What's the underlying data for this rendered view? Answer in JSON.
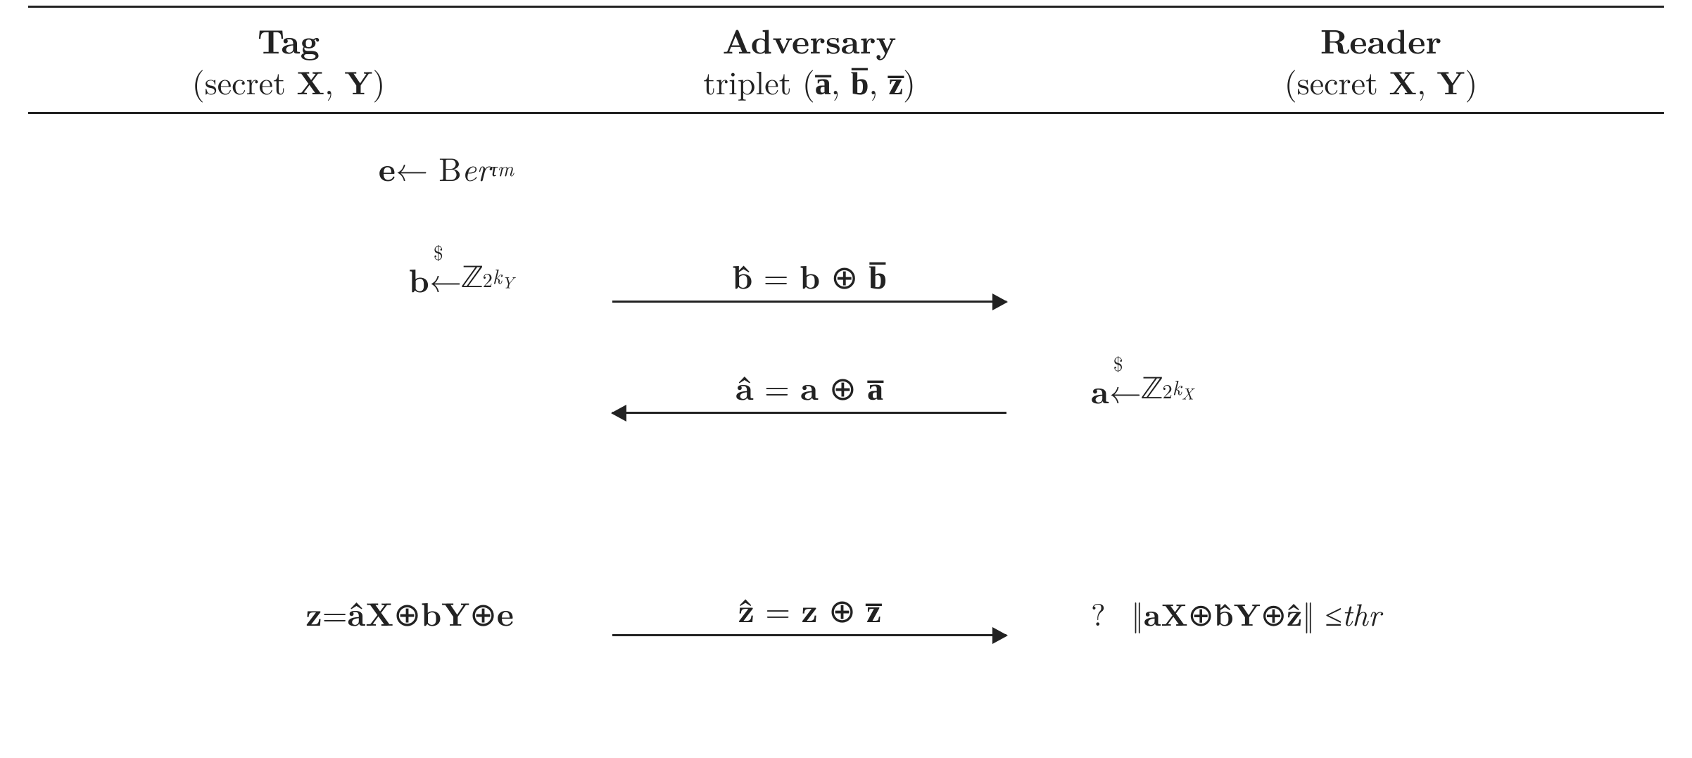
{
  "header": {
    "tag": {
      "title": "Tag",
      "sub": "(secret X, Y)",
      "sub_html": "(secret <b>X</b>, <b>Y</b>)"
    },
    "adv": {
      "title": "Adversary",
      "sub_html": "triplet (<b>a̅</b>, <b>b̅</b>, <b>z̅</b>)"
    },
    "reader": {
      "title": "Reader",
      "sub_html": "(secret <b>X</b>, <b>Y</b>)"
    }
  },
  "tag": {
    "e_sample": "e ← Ber_τ^m",
    "e_sample_html": "<b>e</b> ← B<span class='mi'>er</span><sub><span class='mi'>τ</span></sub><sup><span class='mi'>m</span></sup>",
    "b_sample": "b ←$ Z_2^{k_Y}",
    "b_sample_html": "<b>b</b> <span style='position:relative'>←<span style='position:absolute;left:6px;top:-26px;font-size:.6em'>$</span></span> <span class='bb'>ℤ</span><sub>2</sub><sup><span class='mi'>k</span><sub style='font-size:.8em'><span class='mi'>Y</span></sub></sup>",
    "z_def": "z = âX ⊕ bY ⊕ e",
    "z_def_html": "<b>z</b> = <b>â</b><b>X</b> ⊕ <b>bY</b> ⊕ <b>e</b>"
  },
  "adv": {
    "b_fwd": "b̂ = b ⊕ b̅",
    "b_fwd_html": "<b>b̂</b> = <b>b</b> ⊕ <b>b̅</b>",
    "a_bwd": "â = a ⊕ a̅",
    "a_bwd_html": "<b>â</b> = <b>a</b> ⊕ <b>a̅</b>",
    "z_fwd": "ẑ = z ⊕ z̅",
    "z_fwd_html": "<b>ẑ</b> = <b>z</b> ⊕ <b>z̅</b>"
  },
  "reader": {
    "a_sample": "a ←$ Z_2^{k_X}",
    "a_sample_html": "<b>a</b> <span style='position:relative'>←<span style='position:absolute;left:6px;top:-26px;font-size:.6em'>$</span></span> <span class='bb'>ℤ</span><sub>2</sub><sup><span class='mi'>k</span><sub style='font-size:.8em'><span class='mi'>X</span></sub></sup>",
    "check": "? ‖aX ⊕ b̂Y ⊕ ẑ‖ ≤ thr",
    "check_html": "?&nbsp; ‖<b>aX</b> ⊕ <b>b̂Y</b> ⊕ <b>ẑ</b>‖ ≤ <span class='mi'>thr</span>"
  },
  "chart_data": {
    "type": "table",
    "description": "Cryptographic protocol diagram (HB-style) with Tag, Adversary, Reader columns.",
    "columns": [
      "Tag (secret X,Y)",
      "Adversary triplet (ā,b̄,z̄)",
      "Reader (secret X,Y)"
    ],
    "steps": [
      {
        "actor": "Tag",
        "text": "e ← Ber_τ^m"
      },
      {
        "actor": "Tag",
        "text": "b ←$ Z_2^{k_Y}"
      },
      {
        "actor": "Adversary",
        "direction": "Tag→Reader",
        "text": "b̂ = b ⊕ b̄"
      },
      {
        "actor": "Reader",
        "text": "a ←$ Z_2^{k_X}"
      },
      {
        "actor": "Adversary",
        "direction": "Reader→Tag",
        "text": "â = a ⊕ ā"
      },
      {
        "actor": "Tag",
        "text": "z = âX ⊕ bY ⊕ e"
      },
      {
        "actor": "Adversary",
        "direction": "Tag→Reader",
        "text": "ẑ = z ⊕ z̄"
      },
      {
        "actor": "Reader",
        "text": "? ‖aX ⊕ b̂Y ⊕ ẑ‖ ≤ thr"
      }
    ]
  }
}
